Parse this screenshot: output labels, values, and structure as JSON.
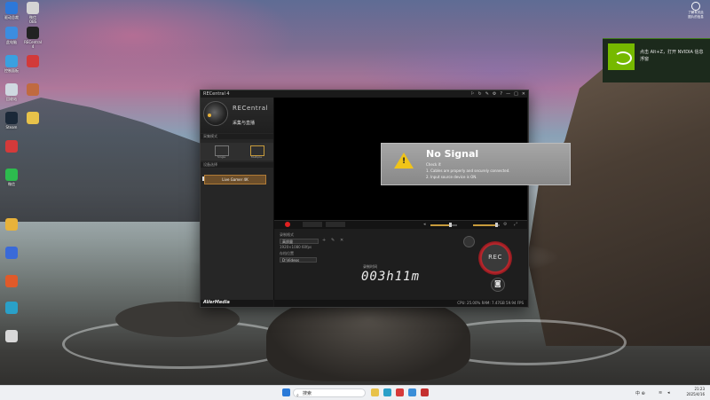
{
  "desktop": {
    "icons": [
      {
        "label": "驱动总裁",
        "name": "driver-icon",
        "color": "#2d78d8"
      },
      {
        "label": "微信\nOBS",
        "name": "app-icon-2",
        "color": "#d4d4d4"
      },
      {
        "label": "此电脑",
        "name": "computer-icon",
        "color": "#3c8de0"
      },
      {
        "label": "RECentral 4",
        "name": "recentral-icon",
        "color": "#222222"
      },
      {
        "label": "控制面板",
        "name": "control-panel-icon",
        "color": "#3aa0e0"
      },
      {
        "label": "",
        "name": "app-icon-6",
        "color": "#d23a3a"
      },
      {
        "label": "回收站",
        "name": "recycle-bin-icon",
        "color": "#cfd8e0"
      },
      {
        "label": "",
        "name": "app-icon-8",
        "color": "#c06a40"
      },
      {
        "label": "Steam",
        "name": "steam-icon",
        "color": "#1b2838"
      },
      {
        "label": "",
        "name": "folder-icon",
        "color": "#e8c24a"
      },
      {
        "label": "",
        "name": "app-icon-11",
        "color": "#d43a3a"
      },
      {
        "label": "微信",
        "name": "wechat-icon",
        "color": "#2dbb4e"
      },
      {
        "label": "",
        "name": "app-icon-13",
        "color": "#e8b23a"
      },
      {
        "label": "",
        "name": "app-icon-14",
        "color": "#3a6ad8"
      },
      {
        "label": "",
        "name": "app-icon-15",
        "color": "#e05a2a"
      },
      {
        "label": "",
        "name": "edge-icon",
        "color": "#2aa0c8"
      },
      {
        "label": "",
        "name": "app-icon-17",
        "color": "#d8d8d8"
      }
    ],
    "top_right_label": "了解有关此\n图片的信息"
  },
  "window": {
    "title": "RECentral 4",
    "controls": [
      "⚐",
      "↻",
      "✎",
      "⚙",
      "?",
      "—",
      "□",
      "✕"
    ],
    "brand": "RECentral",
    "mode_title": "采集与直播",
    "section_mode": "采集模式",
    "mode_single": "Single",
    "mode_multi": "Multiple",
    "section_device": "设备选择",
    "device_name": "Live Gamer 4K",
    "footer_brand": "AVerMedia",
    "no_signal": {
      "title": "No Signal",
      "check": "Check if:",
      "line1": "1. Cables are properly and securely connected.",
      "line2": "2. Input source device is ON."
    },
    "settings": {
      "label1": "录制格式",
      "value1": "高质量",
      "value1b": "1920×1080 60fps",
      "label2": "存档位置",
      "value2": "D:\\Videos"
    },
    "rec_time_label": "录制时间",
    "rec_time": "003h11m",
    "rec_button": "REC",
    "status": "CPU: 25.00%  RAM: 7.47GB  59.94 FPS"
  },
  "notification": {
    "text": "点击 Alt+Z，打开 NVIDIA 信息浮窗"
  },
  "taskbar": {
    "search_placeholder": "搜索",
    "time": "21:23",
    "date": "2025/4/16",
    "tray": "中 ⊕"
  },
  "colors": {
    "accent": "#c79b3c",
    "rec_red": "#c2272d",
    "nvidia_green": "#76b900",
    "device_bg": "#6c4e2a"
  }
}
